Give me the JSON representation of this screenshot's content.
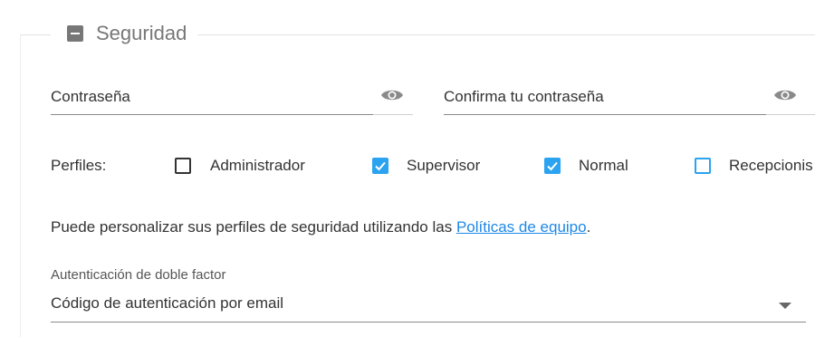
{
  "section": {
    "title": "Seguridad",
    "collapse_icon": "minus-square-icon"
  },
  "password": {
    "label": "Contraseña",
    "icon": "eye-icon"
  },
  "confirm_password": {
    "label": "Confirma tu contraseña",
    "icon": "eye-icon"
  },
  "profiles": {
    "label": "Perfiles:",
    "items": [
      {
        "label": "Administrador",
        "checked": false
      },
      {
        "label": "Supervisor",
        "checked": true
      },
      {
        "label": "Normal",
        "checked": true
      },
      {
        "label": "Recepcionis",
        "checked": false
      }
    ]
  },
  "info": {
    "text": "Puede personalizar sus perfiles de seguridad utilizando las ",
    "link": "Políticas de equipo",
    "suffix": "."
  },
  "two_factor": {
    "label": "Autenticación de doble factor",
    "value": "Código de autenticación por email"
  },
  "colors": {
    "accent": "#2ba3f0",
    "link": "#1e88e5",
    "legend": "#777777"
  }
}
